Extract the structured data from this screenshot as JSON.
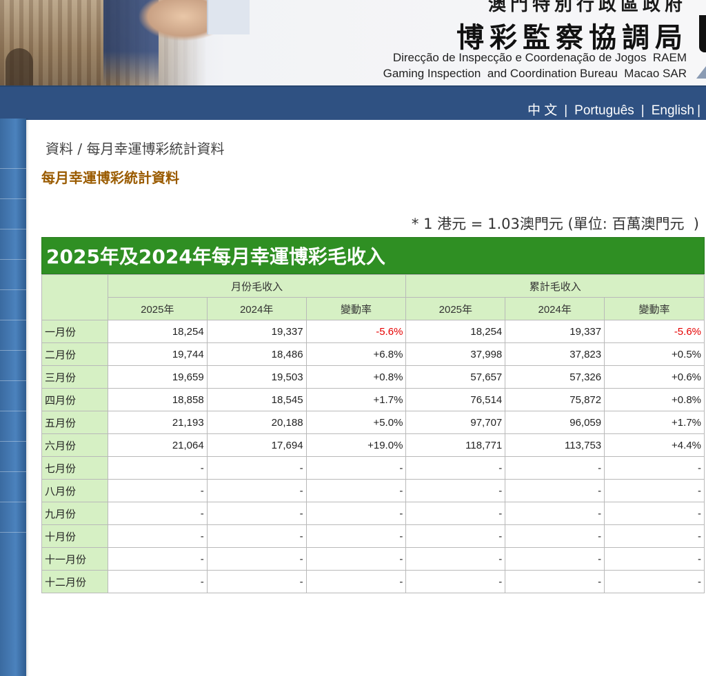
{
  "header": {
    "gov_name": "澳門特別行政區政府",
    "bureau_cn": "博彩監察協調局",
    "bureau_pt": "Direcção de Inspecção e Coordenação de Jogos  RAEM",
    "bureau_en": "Gaming Inspection  and Coordination Bureau  Macao SAR"
  },
  "languages": [
    "中 文",
    "Português",
    "English"
  ],
  "breadcrumb": "資料 / 每月幸運博彩統計資料",
  "page_title": "每月幸運博彩統計資料",
  "rate_note": "* 1 港元 = 1.03澳門元 (單位: 百萬澳門元  )",
  "table": {
    "title": "2025年及2024年每月幸運博彩毛收入",
    "group_monthly": "月份毛收入",
    "group_cumulative": "累計毛收入",
    "col_headers": [
      "2025年",
      "2024年",
      "變動率",
      "2025年",
      "2024年",
      "變動率"
    ],
    "rows": [
      {
        "month": "一月份",
        "m2025": "18,254",
        "m2024": "19,337",
        "mchg": "-5.6%",
        "c2025": "18,254",
        "c2024": "19,337",
        "cchg": "-5.6%"
      },
      {
        "month": "二月份",
        "m2025": "19,744",
        "m2024": "18,486",
        "mchg": "+6.8%",
        "c2025": "37,998",
        "c2024": "37,823",
        "cchg": "+0.5%"
      },
      {
        "month": "三月份",
        "m2025": "19,659",
        "m2024": "19,503",
        "mchg": "+0.8%",
        "c2025": "57,657",
        "c2024": "57,326",
        "cchg": "+0.6%"
      },
      {
        "month": "四月份",
        "m2025": "18,858",
        "m2024": "18,545",
        "mchg": "+1.7%",
        "c2025": "76,514",
        "c2024": "75,872",
        "cchg": "+0.8%"
      },
      {
        "month": "五月份",
        "m2025": "21,193",
        "m2024": "20,188",
        "mchg": "+5.0%",
        "c2025": "97,707",
        "c2024": "96,059",
        "cchg": "+1.7%"
      },
      {
        "month": "六月份",
        "m2025": "21,064",
        "m2024": "17,694",
        "mchg": "+19.0%",
        "c2025": "118,771",
        "c2024": "113,753",
        "cchg": "+4.4%"
      },
      {
        "month": "七月份",
        "m2025": "-",
        "m2024": "-",
        "mchg": "-",
        "c2025": "-",
        "c2024": "-",
        "cchg": "-"
      },
      {
        "month": "八月份",
        "m2025": "-",
        "m2024": "-",
        "mchg": "-",
        "c2025": "-",
        "c2024": "-",
        "cchg": "-"
      },
      {
        "month": "九月份",
        "m2025": "-",
        "m2024": "-",
        "mchg": "-",
        "c2025": "-",
        "c2024": "-",
        "cchg": "-"
      },
      {
        "month": "十月份",
        "m2025": "-",
        "m2024": "-",
        "mchg": "-",
        "c2025": "-",
        "c2024": "-",
        "cchg": "-"
      },
      {
        "month": "十一月份",
        "m2025": "-",
        "m2024": "-",
        "mchg": "-",
        "c2025": "-",
        "c2024": "-",
        "cchg": "-"
      },
      {
        "month": "十二月份",
        "m2025": "-",
        "m2024": "-",
        "mchg": "-",
        "c2025": "-",
        "c2024": "-",
        "cchg": "-"
      }
    ]
  },
  "colors": {
    "nav_blue": "#2f5182",
    "table_title_green": "#2f8f23",
    "header_cell_green": "#d6f0c4",
    "page_title_brown": "#9a5b00",
    "negative_red": "#e60000"
  }
}
